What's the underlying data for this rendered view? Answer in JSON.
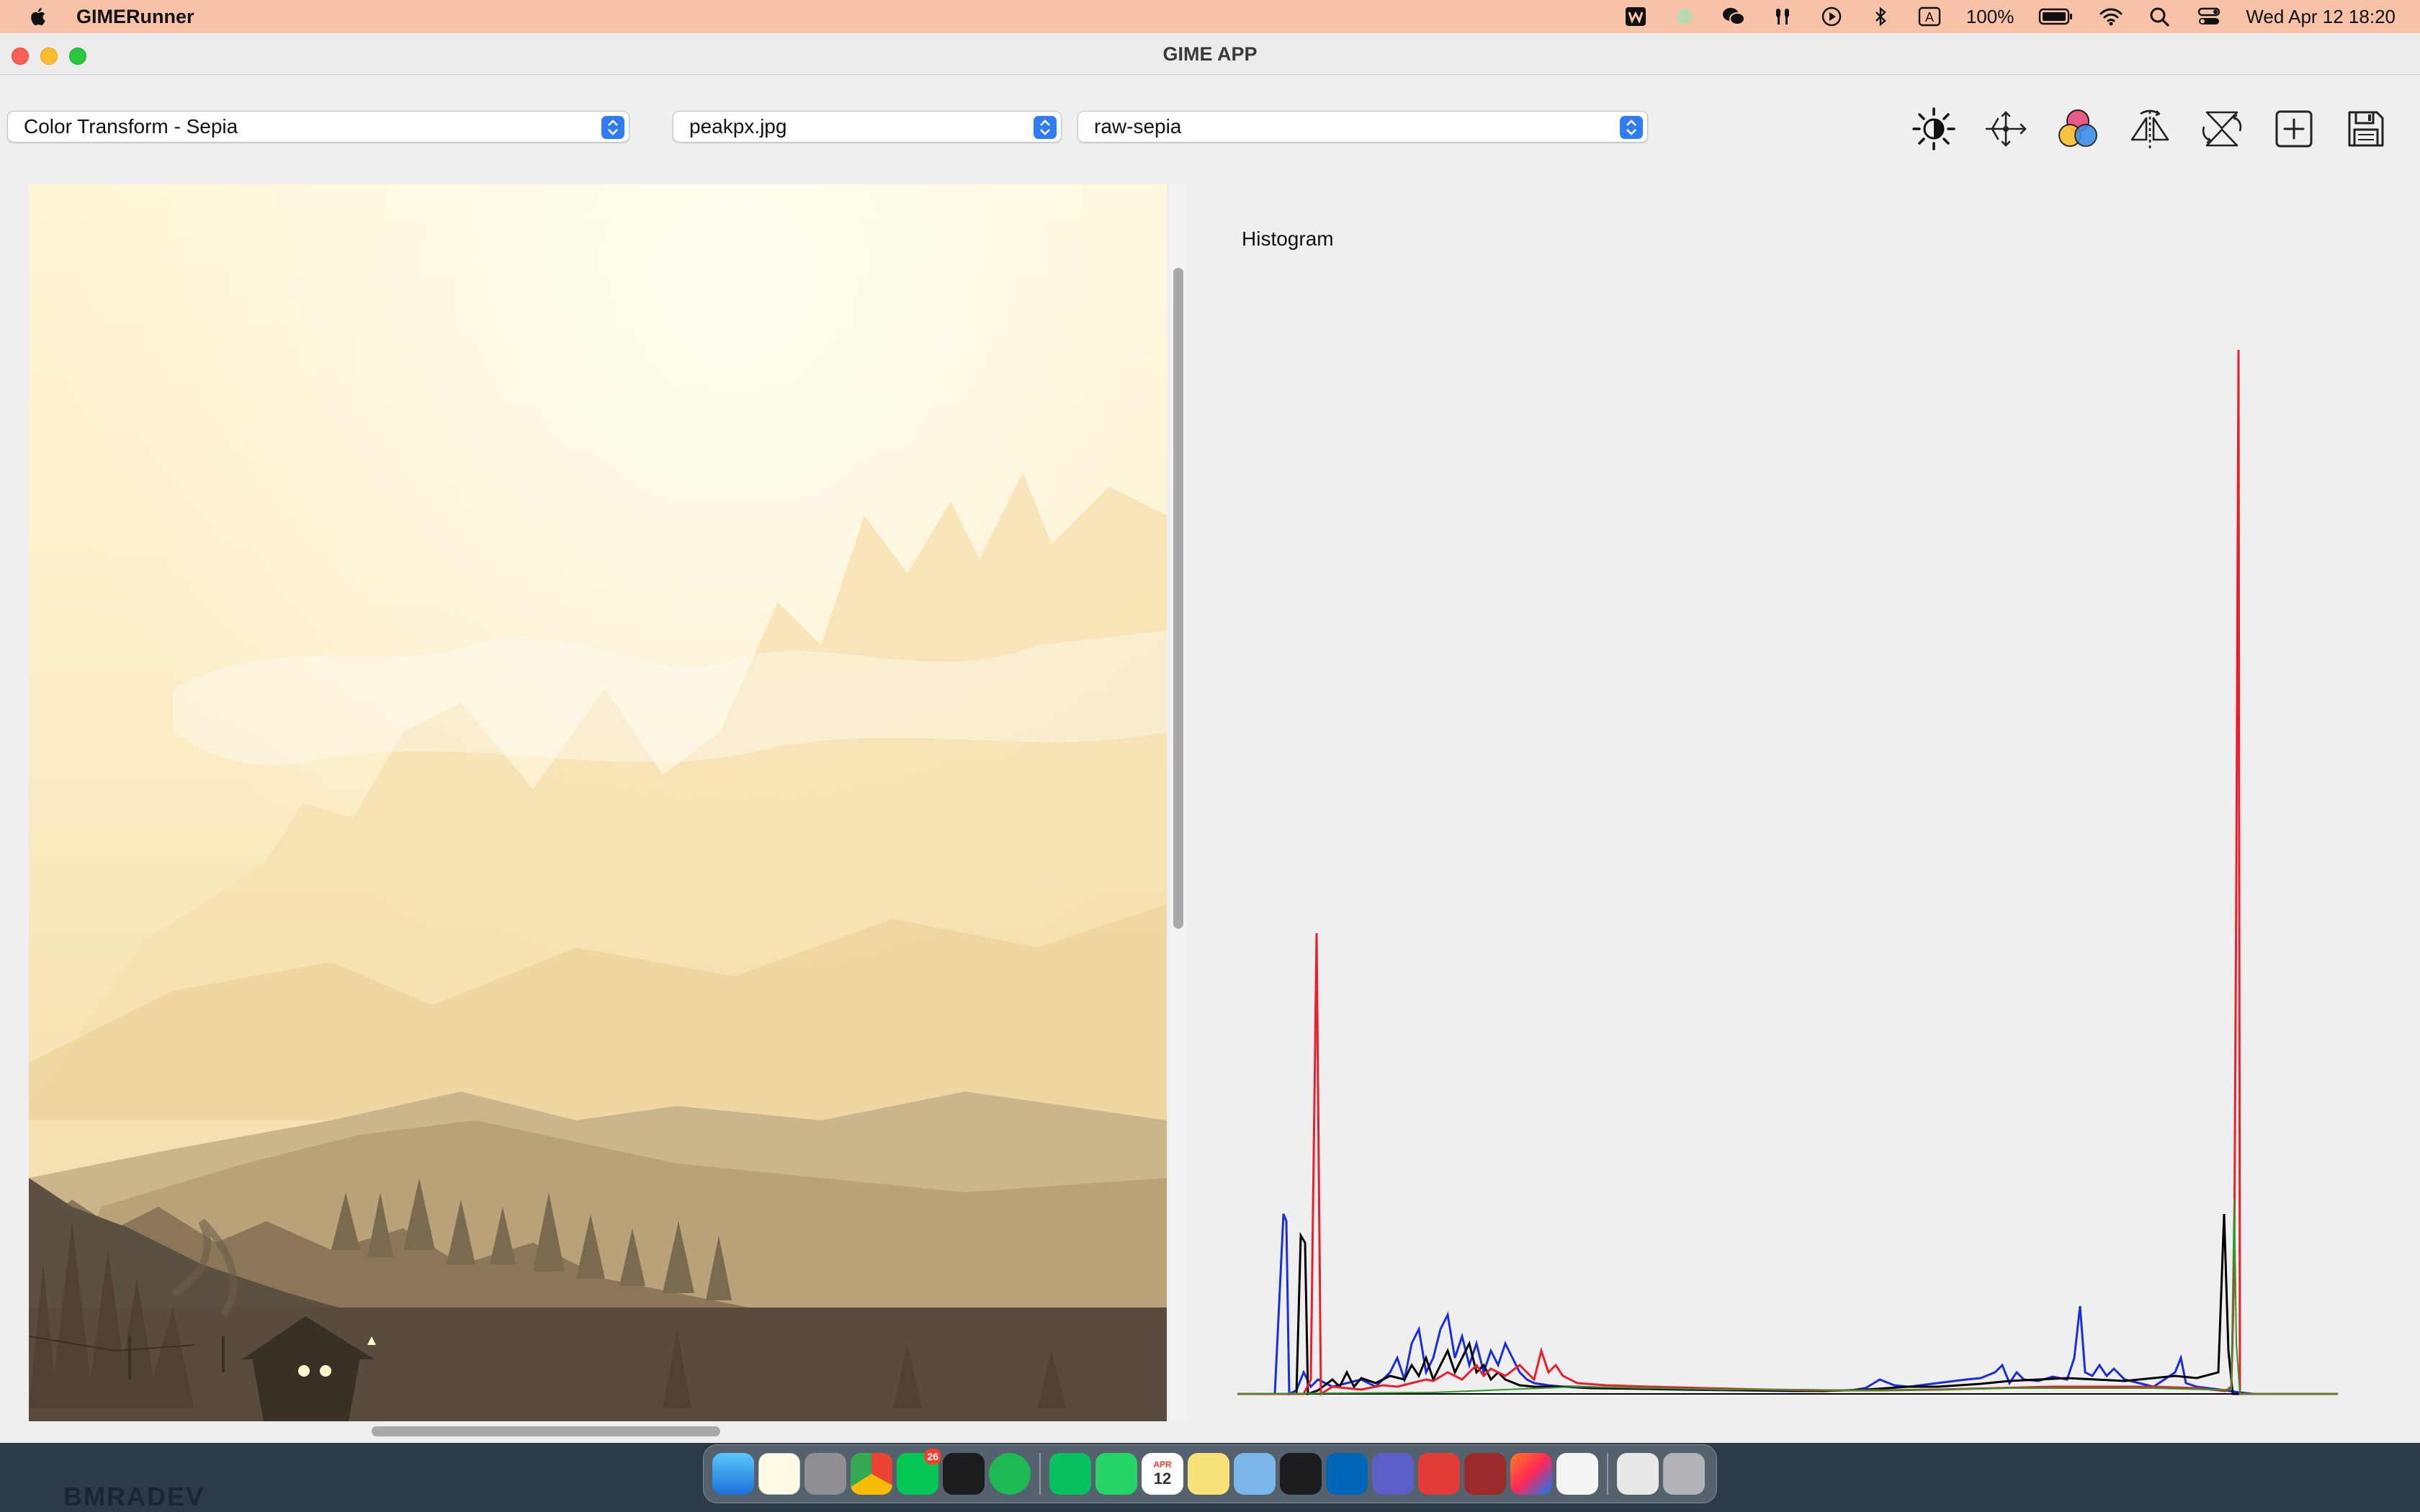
{
  "menubar": {
    "app_name": "GIMERunner",
    "battery": "100%",
    "input_indicator": "A",
    "datetime": "Wed Apr 12  18:20"
  },
  "window": {
    "title": "GIME APP"
  },
  "toolbar": {
    "transform_select": {
      "value": "Color Transform - Sepia"
    },
    "file_select": {
      "value": "peakpx.jpg"
    },
    "variant_select": {
      "value": "raw-sepia"
    },
    "buttons": [
      "brightness-icon",
      "transform-icon",
      "color-channels-icon",
      "flip-icon",
      "rotate-icon",
      "add-icon",
      "save-icon"
    ]
  },
  "histogram": {
    "title": "Histogram",
    "colors": {
      "red": "#e8202a",
      "green": "#2a9a2a",
      "blue": "#1a2ee0",
      "black": "#000000"
    }
  },
  "dock": {
    "apps": [
      "Finder",
      "Notes",
      "System Settings",
      "Chrome",
      "LINE",
      "Terminal",
      "Spotify",
      "WeChat",
      "WhatsApp",
      "Calendar",
      "Stickies",
      "Preview",
      "Stocks",
      "VS Code",
      "Teams",
      "WPS",
      "Dictionary",
      "IntelliJ IDEA",
      "Java",
      "Documents",
      "Trash"
    ],
    "line_badge": "26",
    "calendar_day": "12",
    "calendar_month": "APR"
  },
  "desktop_text": "BMRADEV"
}
